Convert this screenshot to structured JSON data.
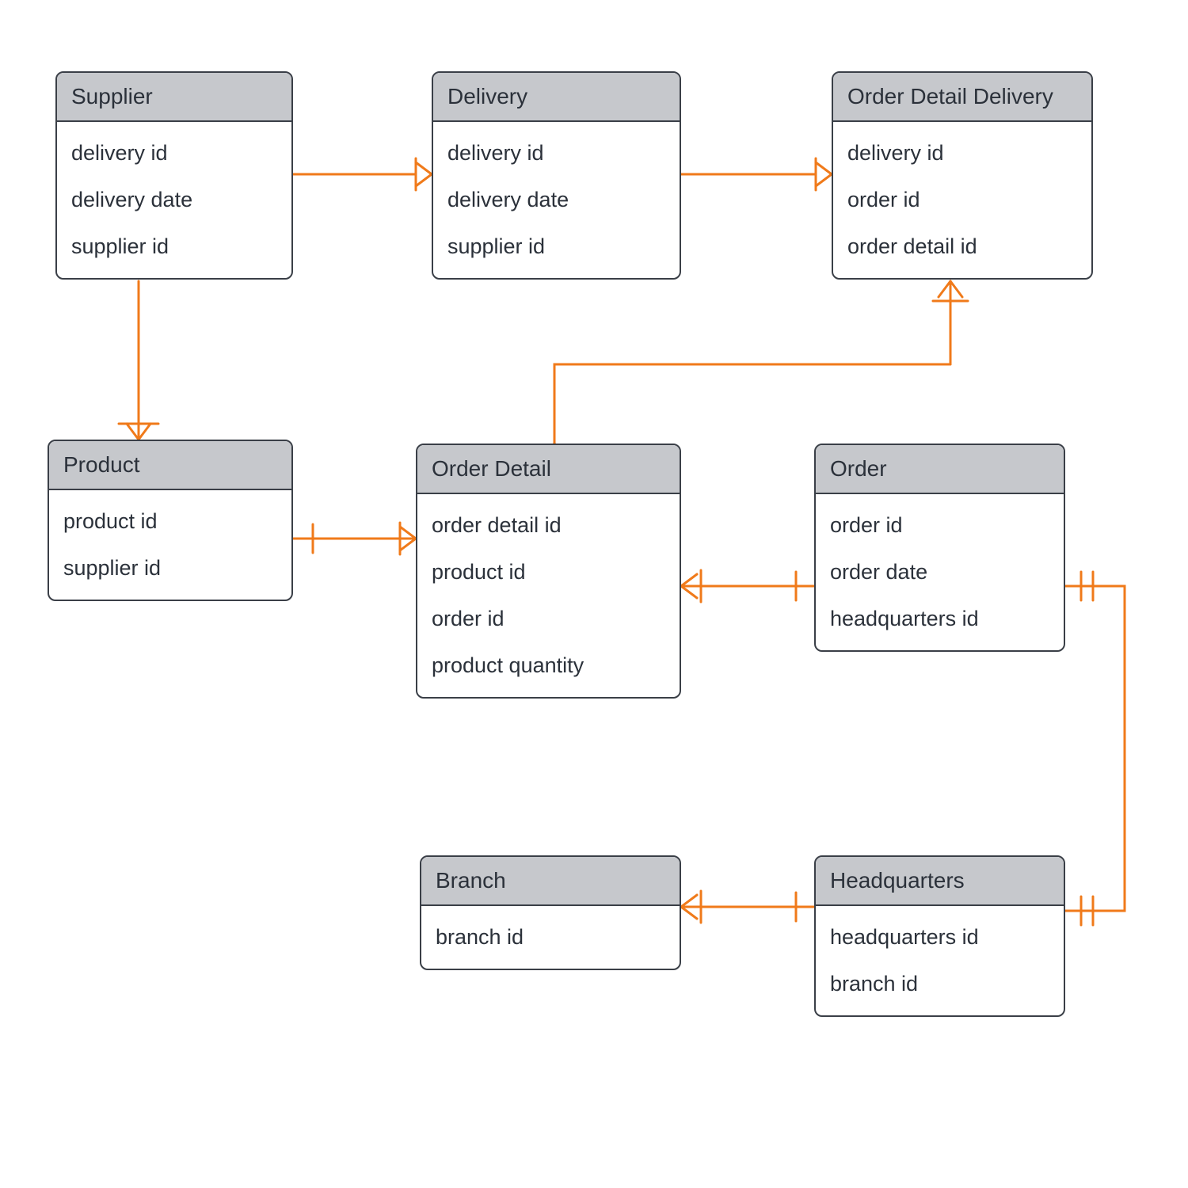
{
  "diagram_type": "Entity-Relationship Diagram",
  "entities": {
    "supplier": {
      "title": "Supplier",
      "attributes": [
        "delivery id",
        "delivery date",
        "supplier id"
      ]
    },
    "delivery": {
      "title": "Delivery",
      "attributes": [
        "delivery id",
        "delivery date",
        "supplier id"
      ]
    },
    "order_detail_delivery": {
      "title": "Order Detail Delivery",
      "attributes": [
        "delivery id",
        "order id",
        "order detail id"
      ]
    },
    "product": {
      "title": "Product",
      "attributes": [
        "product id",
        "supplier id"
      ]
    },
    "order_detail": {
      "title": "Order Detail",
      "attributes": [
        "order detail id",
        "product id",
        "order id",
        "product quantity"
      ]
    },
    "order": {
      "title": "Order",
      "attributes": [
        "order id",
        "order date",
        "headquarters id"
      ]
    },
    "branch": {
      "title": "Branch",
      "attributes": [
        "branch id"
      ]
    },
    "headquarters": {
      "title": "Headquarters",
      "attributes": [
        "headquarters id",
        "branch id"
      ]
    }
  },
  "relationships": [
    {
      "from": "supplier",
      "to": "delivery",
      "type": "one-to-many"
    },
    {
      "from": "delivery",
      "to": "order_detail_delivery",
      "type": "one-to-many"
    },
    {
      "from": "supplier",
      "to": "product",
      "type": "one-to-many"
    },
    {
      "from": "product",
      "to": "order_detail",
      "type": "one-to-many"
    },
    {
      "from": "order_detail",
      "to": "order_detail_delivery",
      "type": "one-to-many"
    },
    {
      "from": "order",
      "to": "order_detail",
      "type": "one-to-many"
    },
    {
      "from": "headquarters",
      "to": "order",
      "type": "one-to-one"
    },
    {
      "from": "headquarters",
      "to": "branch",
      "type": "one-to-many"
    }
  ],
  "colors": {
    "connector": "#f07a1a",
    "entity_border": "#3a3f47",
    "entity_header": "#c6c8cc"
  }
}
